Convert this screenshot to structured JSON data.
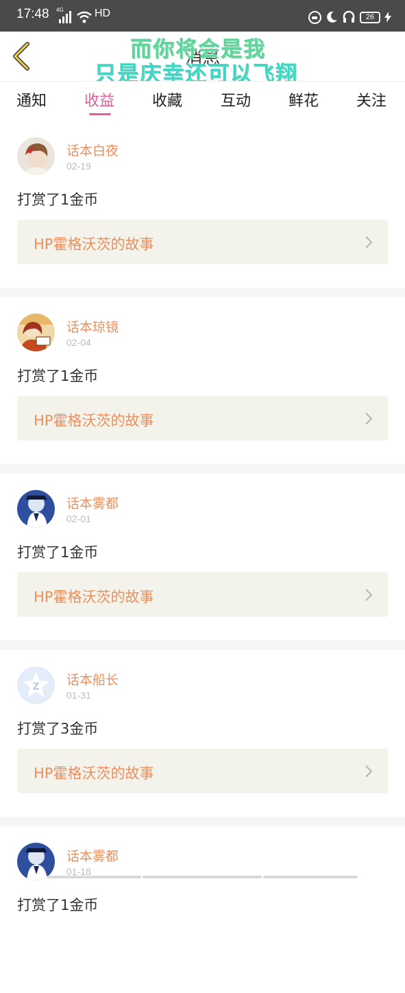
{
  "status_bar": {
    "time": "17:48",
    "network": "4G",
    "hd": "HD",
    "battery": "26"
  },
  "header": {
    "title": "消息",
    "overlay_line1": "而你将会是我",
    "overlay_line2": "只是庆幸还可以飞翔"
  },
  "tabs": [
    {
      "label": "通知"
    },
    {
      "label": "收益"
    },
    {
      "label": "收藏"
    },
    {
      "label": "互动"
    },
    {
      "label": "鲜花"
    },
    {
      "label": "关注"
    }
  ],
  "active_tab": "收益",
  "colors": {
    "accent": "#e25b9a",
    "nickname": "#ec8f5c",
    "book_bg": "#f3f3ec"
  },
  "items": [
    {
      "user": "话本白夜",
      "date": "02-19",
      "message": "打赏了1金币",
      "book": "HP霍格沃茨的故事",
      "avatar": "girl-avatar"
    },
    {
      "user": "话本琼镜",
      "date": "02-04",
      "message": "打赏了1金币",
      "book": "HP霍格沃茨的故事",
      "avatar": "anime-avatar"
    },
    {
      "user": "话本雾都",
      "date": "02-01",
      "message": "打赏了1金币",
      "book": "HP霍格沃茨的故事",
      "avatar": "kid-avatar"
    },
    {
      "user": "话本船长",
      "date": "01-31",
      "message": "打赏了3金币",
      "book": "HP霍格沃茨的故事",
      "avatar": "default-avatar"
    },
    {
      "user": "话本雾都",
      "date": "01-18",
      "message": "打赏了1金币",
      "book": "",
      "avatar": "kid-avatar"
    }
  ]
}
